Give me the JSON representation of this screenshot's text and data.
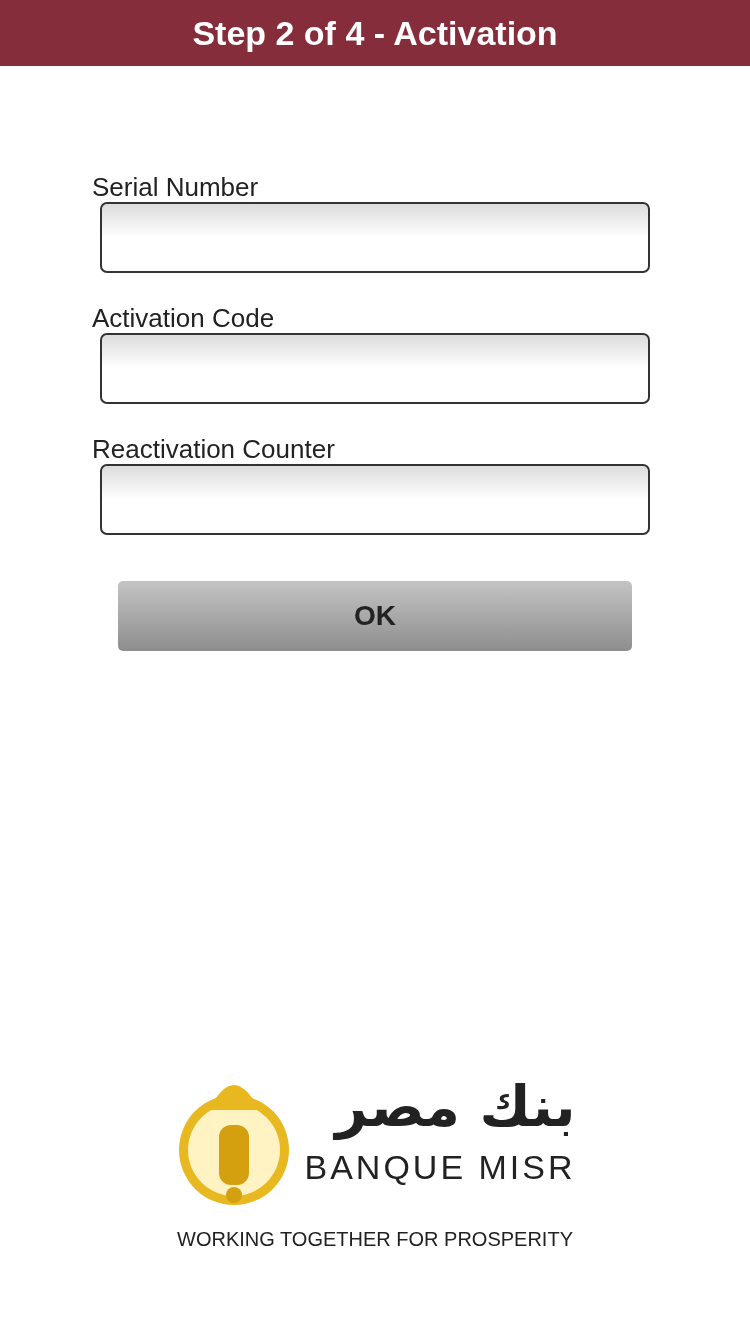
{
  "header": {
    "title": "Step 2 of 4 - Activation"
  },
  "fields": [
    {
      "label": "Serial Number"
    },
    {
      "label": "Activation Code"
    },
    {
      "label": "Reactivation Counter"
    }
  ],
  "ok_button": {
    "label": "OK"
  },
  "logo": {
    "arabic_name": "بنك مصر",
    "name": "BANQUE MISR",
    "tagline": "WORKING TOGETHER FOR PROSPERITY"
  }
}
